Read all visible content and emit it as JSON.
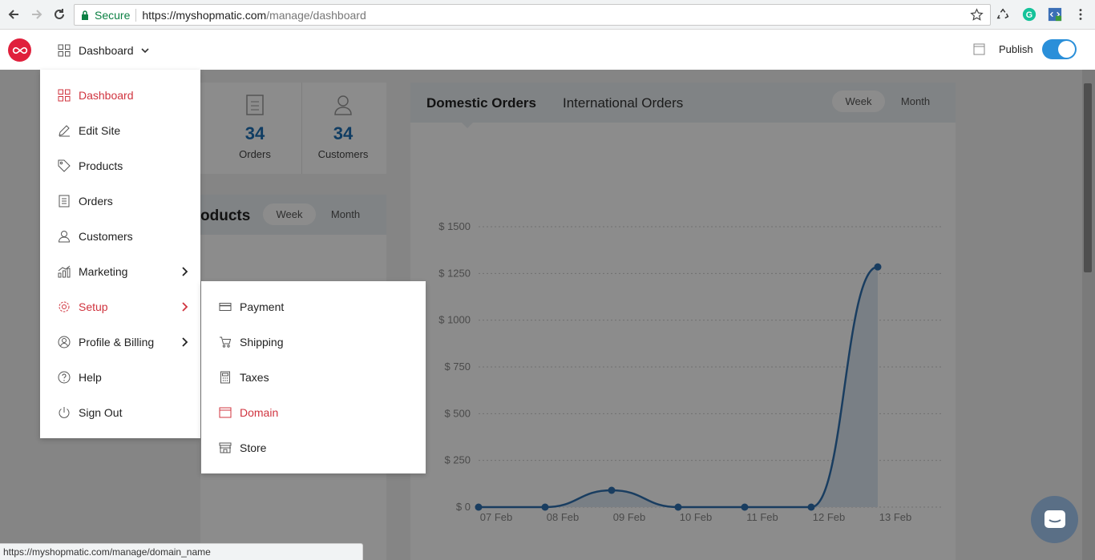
{
  "browser": {
    "secure_label": "Secure",
    "url_host": "https://myshopmatic.com",
    "url_path": "/manage/dashboard",
    "status_url": "https://myshopmatic.com/manage/domain_name"
  },
  "header": {
    "menu_label": "Dashboard",
    "publish_label": "Publish",
    "publish_on": true,
    "accent": "#2a8fd9",
    "brand": "#e0203c"
  },
  "stats": [
    {
      "value": "34",
      "label": "Orders",
      "icon": "orders-icon"
    },
    {
      "value": "34",
      "label": "Customers",
      "icon": "customer-icon"
    }
  ],
  "products_card": {
    "title": "oducts",
    "week": "Week",
    "month": "Month"
  },
  "orders_card": {
    "tab_domestic": "Domestic Orders",
    "tab_international": "International Orders",
    "week": "Week",
    "month": "Month"
  },
  "chart_data": {
    "type": "area",
    "x": [
      "07 Feb",
      "08 Feb",
      "09 Feb",
      "10 Feb",
      "11 Feb",
      "12 Feb",
      "13 Feb"
    ],
    "y_ticks": [
      "$ 0",
      "$ 250",
      "$ 500",
      "$ 750",
      "$ 1000",
      "$ 1250",
      "$ 1500"
    ],
    "ylim": [
      0,
      1500
    ],
    "values": [
      0,
      0,
      90,
      0,
      0,
      0,
      1285
    ],
    "color": "#2e6fb0",
    "grid": true
  },
  "menu": {
    "items": [
      {
        "label": "Dashboard",
        "icon": "dashboard-icon",
        "active": true
      },
      {
        "label": "Edit Site",
        "icon": "pencil-icon"
      },
      {
        "label": "Products",
        "icon": "tag-icon"
      },
      {
        "label": "Orders",
        "icon": "orders-icon"
      },
      {
        "label": "Customers",
        "icon": "customer-icon"
      },
      {
        "label": "Marketing",
        "icon": "marketing-icon",
        "submenu": true
      },
      {
        "label": "Setup",
        "icon": "gear-icon",
        "submenu": true,
        "active": true
      },
      {
        "label": "Profile & Billing",
        "icon": "profile-icon",
        "submenu": true
      },
      {
        "label": "Help",
        "icon": "help-icon"
      },
      {
        "label": "Sign Out",
        "icon": "power-icon"
      }
    ]
  },
  "submenu": {
    "items": [
      {
        "label": "Payment",
        "icon": "card-icon"
      },
      {
        "label": "Shipping",
        "icon": "cart-icon"
      },
      {
        "label": "Taxes",
        "icon": "calculator-icon"
      },
      {
        "label": "Domain",
        "icon": "browser-window-icon",
        "active": true
      },
      {
        "label": "Store",
        "icon": "store-icon"
      }
    ]
  }
}
